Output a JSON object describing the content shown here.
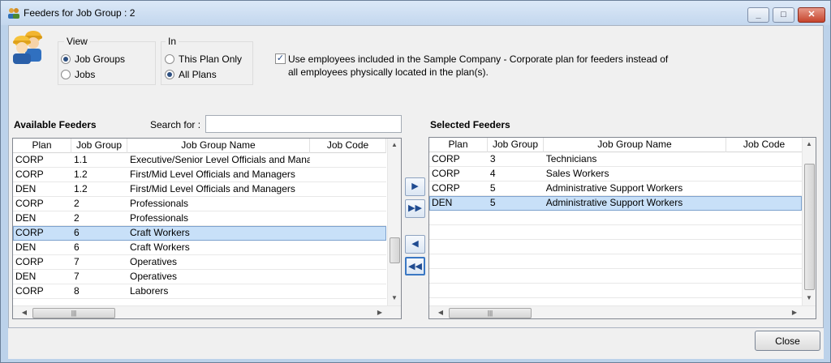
{
  "window": {
    "title": "Feeders for Job Group : 2"
  },
  "view_group": {
    "label": "View",
    "options": [
      {
        "label": "Job Groups",
        "selected": true
      },
      {
        "label": "Jobs",
        "selected": false
      }
    ]
  },
  "in_group": {
    "label": "In",
    "options": [
      {
        "label": "This Plan Only",
        "selected": false
      },
      {
        "label": "All Plans",
        "selected": true
      }
    ]
  },
  "sample_company_checkbox": {
    "checked": true,
    "line1": "Use employees included in the Sample Company - Corporate plan for feeders instead of",
    "line2": "all employees physically located in the plan(s)."
  },
  "available": {
    "title": "Available Feeders",
    "search_label": "Search for :",
    "search_value": "",
    "columns": [
      "Plan",
      "Job Group",
      "Job Group Name",
      "Job Code"
    ],
    "rows": [
      {
        "plan": "CORP",
        "job_group": "1.1",
        "name": "Executive/Senior Level Officials and Managers",
        "code": ""
      },
      {
        "plan": "CORP",
        "job_group": "1.2",
        "name": "First/Mid Level Officials and Managers",
        "code": ""
      },
      {
        "plan": "DEN",
        "job_group": "1.2",
        "name": "First/Mid Level Officials and Managers",
        "code": ""
      },
      {
        "plan": "CORP",
        "job_group": "2",
        "name": "Professionals",
        "code": ""
      },
      {
        "plan": "DEN",
        "job_group": "2",
        "name": "Professionals",
        "code": ""
      },
      {
        "plan": "CORP",
        "job_group": "6",
        "name": "Craft Workers",
        "code": "",
        "selected": true
      },
      {
        "plan": "DEN",
        "job_group": "6",
        "name": "Craft Workers",
        "code": ""
      },
      {
        "plan": "CORP",
        "job_group": "7",
        "name": "Operatives",
        "code": ""
      },
      {
        "plan": "DEN",
        "job_group": "7",
        "name": "Operatives",
        "code": ""
      },
      {
        "plan": "CORP",
        "job_group": "8",
        "name": "Laborers",
        "code": ""
      }
    ]
  },
  "selected": {
    "title": "Selected Feeders",
    "columns": [
      "Plan",
      "Job Group",
      "Job Group Name",
      "Job Code"
    ],
    "rows": [
      {
        "plan": "CORP",
        "job_group": "3",
        "name": "Technicians",
        "code": ""
      },
      {
        "plan": "CORP",
        "job_group": "4",
        "name": "Sales Workers",
        "code": ""
      },
      {
        "plan": "CORP",
        "job_group": "5",
        "name": "Administrative Support Workers",
        "code": ""
      },
      {
        "plan": "DEN",
        "job_group": "5",
        "name": "Administrative Support Workers",
        "code": "",
        "selected": true
      }
    ]
  },
  "move_buttons": [
    {
      "icon": "arrow-right-icon",
      "glyph": "▶"
    },
    {
      "icon": "double-arrow-right-icon",
      "glyph": "▶▶"
    },
    {
      "icon": "arrow-left-icon",
      "glyph": "◀"
    },
    {
      "icon": "double-arrow-left-icon",
      "glyph": "◀◀"
    }
  ],
  "footer": {
    "close_label": "Close"
  }
}
